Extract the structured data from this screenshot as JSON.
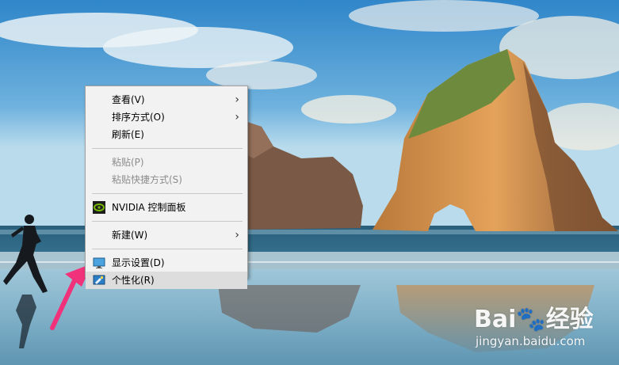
{
  "context_menu": {
    "items": [
      {
        "label": "查看(V)",
        "submenu": true,
        "disabled": false
      },
      {
        "label": "排序方式(O)",
        "submenu": true,
        "disabled": false
      },
      {
        "label": "刷新(E)",
        "submenu": false,
        "disabled": false
      },
      {
        "label": "粘贴(P)",
        "submenu": false,
        "disabled": true
      },
      {
        "label": "粘贴快捷方式(S)",
        "submenu": false,
        "disabled": true
      },
      {
        "label": "NVIDIA 控制面板",
        "icon": "nvidia-icon",
        "disabled": false
      },
      {
        "label": "新建(W)",
        "submenu": true,
        "disabled": false
      },
      {
        "label": "显示设置(D)",
        "icon": "display-settings-icon",
        "disabled": false
      },
      {
        "label": "个性化(R)",
        "icon": "personalize-icon",
        "disabled": false,
        "highlighted": true
      }
    ],
    "chevron_glyph": "›"
  },
  "watermark": {
    "brand": "Bai",
    "brand_suffix": "经验",
    "site": "jingyan.baidu.com"
  },
  "colors": {
    "accent_arrow": "#f0327a",
    "menu_bg": "#f2f2f2",
    "menu_highlight": "#dddddd",
    "nvidia_green": "#76b900"
  }
}
